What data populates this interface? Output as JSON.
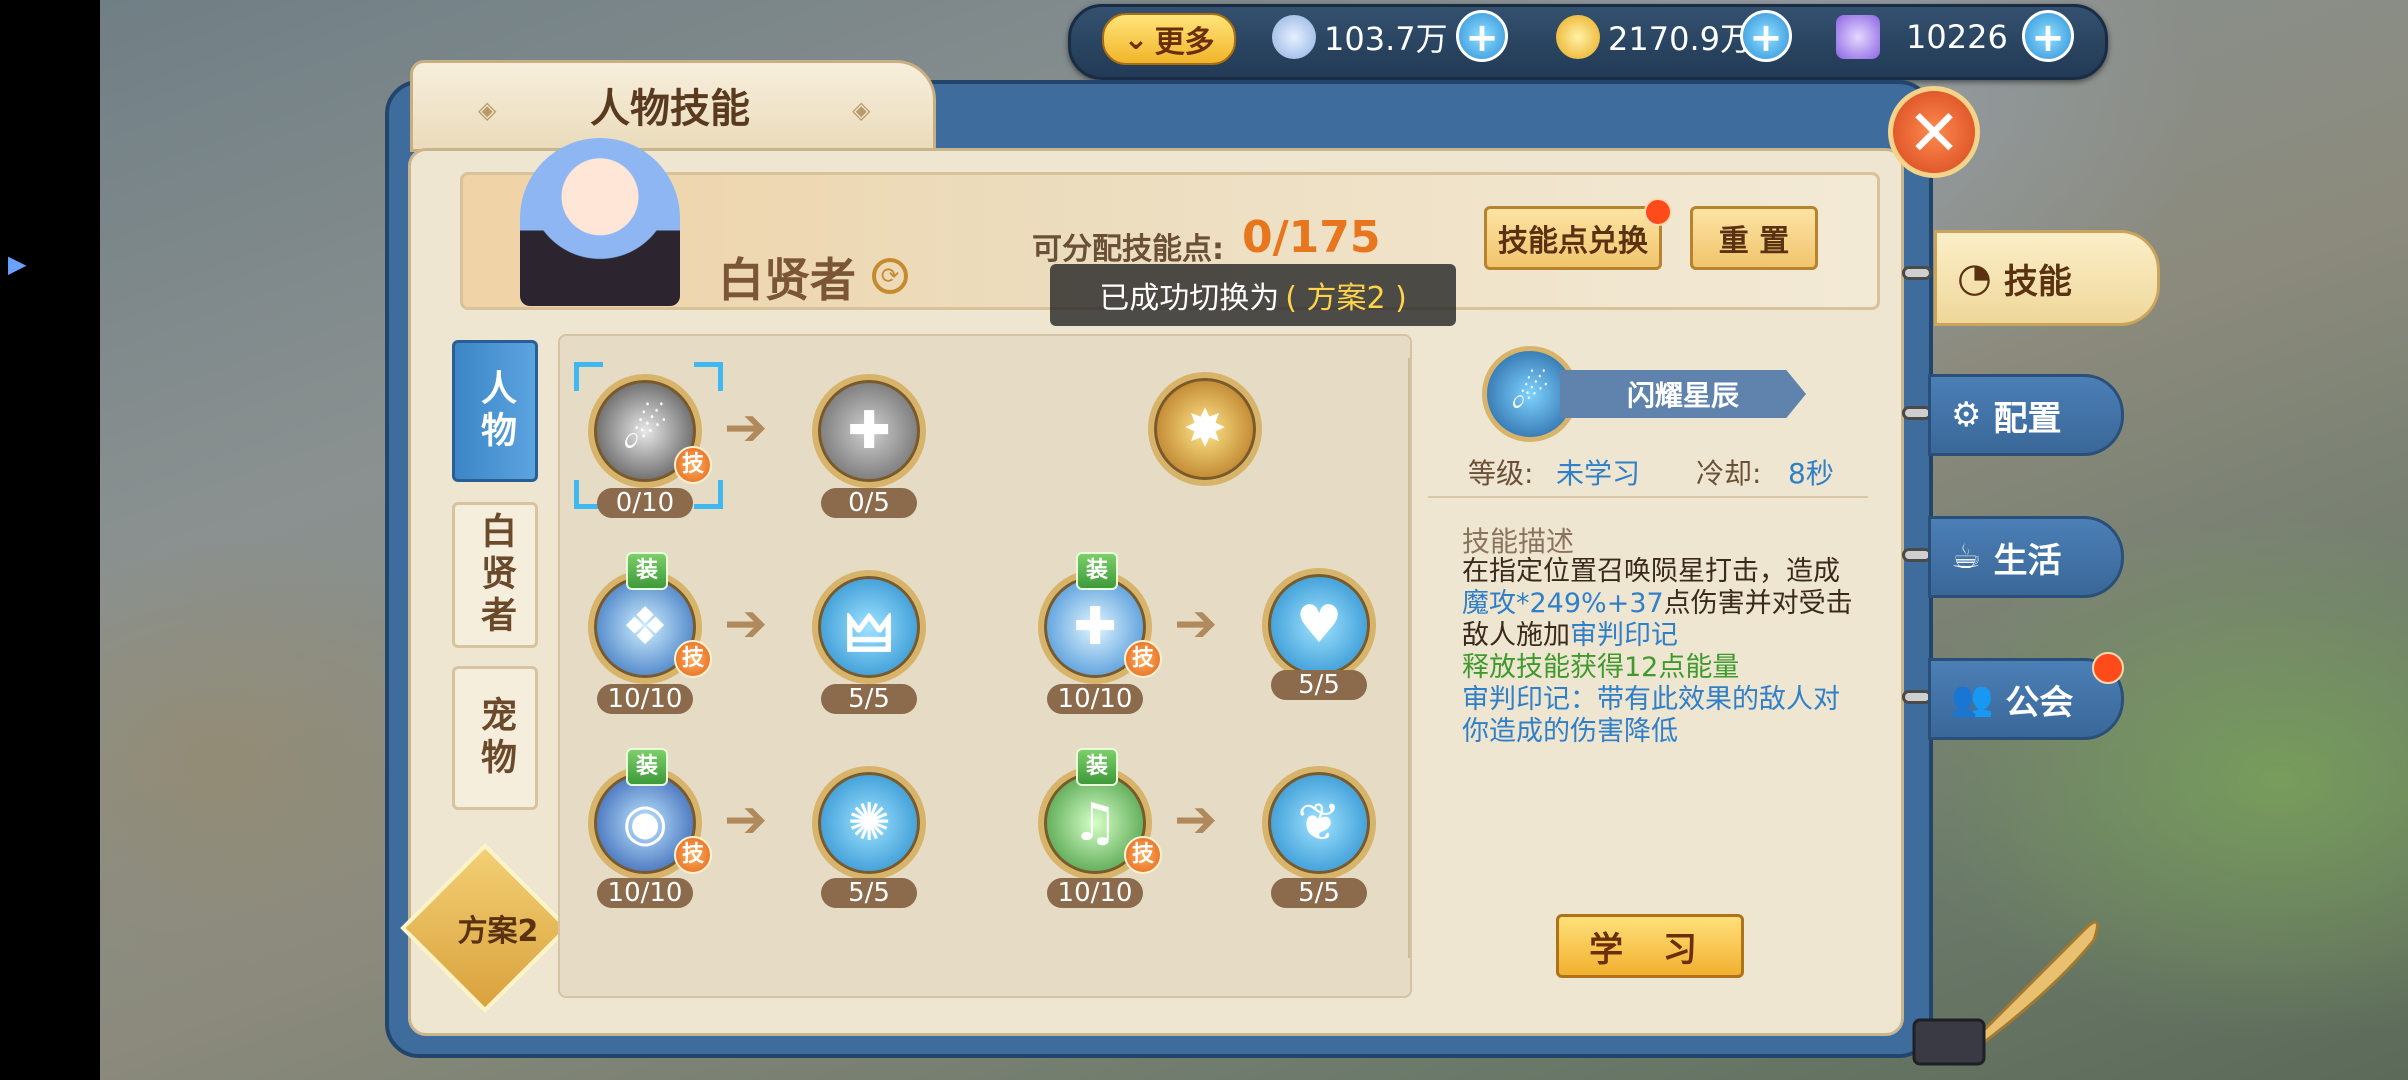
{
  "topbar": {
    "more_label": "更多",
    "currencies": [
      {
        "icon": "feather-leaf-icon",
        "value": "103.7万",
        "color": "#a9c8ef"
      },
      {
        "icon": "gold-leaf-icon",
        "value": "2170.9万",
        "color": "#f3c233"
      },
      {
        "icon": "crystal-gem-icon",
        "value": "10226",
        "color": "#a77cf0"
      }
    ]
  },
  "panel": {
    "title": "人物技能",
    "character_name": "白贤者",
    "points_label": "可分配技能点:",
    "points_value": "0/175",
    "exchange_button": "技能点兑换",
    "reset_button": "重 置",
    "toast_text": "已成功切换为",
    "toast_highlight": "( 方案2 )",
    "plan_label": "方案2"
  },
  "side_tabs": [
    "人物",
    "白贤者",
    "宠物"
  ],
  "skills": {
    "row1": [
      {
        "count": "0/10",
        "tag": "技",
        "icon": "meteor-strike-icon"
      },
      {
        "count": "0/5",
        "icon": "upgrade-heal-icon"
      },
      {
        "icon": "golden-burst-icon"
      }
    ],
    "row2": [
      {
        "count": "10/10",
        "tag": "技",
        "equip": "装",
        "icon": "blue-eagle-icon"
      },
      {
        "count": "5/5",
        "icon": "wings-icon"
      },
      {
        "count": "10/10",
        "tag": "技",
        "equip": "装",
        "icon": "holy-cross-icon"
      },
      {
        "count": "5/5",
        "icon": "heart-hands-icon"
      }
    ],
    "row3": [
      {
        "count": "10/10",
        "tag": "技",
        "equip": "装",
        "icon": "arcane-orb-icon"
      },
      {
        "count": "5/5",
        "icon": "burst-icon"
      },
      {
        "count": "10/10",
        "tag": "技",
        "equip": "装",
        "icon": "music-note-icon"
      },
      {
        "count": "5/5",
        "icon": "feather-wing-icon"
      }
    ]
  },
  "detail": {
    "skill_name": "闪耀星辰",
    "level_label": "等级:",
    "level_value": "未学习",
    "cooldown_label": "冷却:",
    "cooldown_value": "8秒",
    "desc_title": "技能描述",
    "desc_line1": "在指定位置召唤陨星打击，造成",
    "desc_line2_blue": "魔攻*249%+37",
    "desc_line2_rest": "点伤害并对受击",
    "desc_line3_dark": "敌人施加",
    "desc_line3_blue": "审判印记",
    "desc_line4": "释放技能获得12点能量",
    "desc_line5": "审判印记：带有此效果的敌人对",
    "desc_line6": "你造成的伤害降低",
    "learn_button": "学 习"
  },
  "right_tabs": {
    "skill": "技能",
    "config": "配置",
    "life": "生活",
    "guild": "公会"
  }
}
